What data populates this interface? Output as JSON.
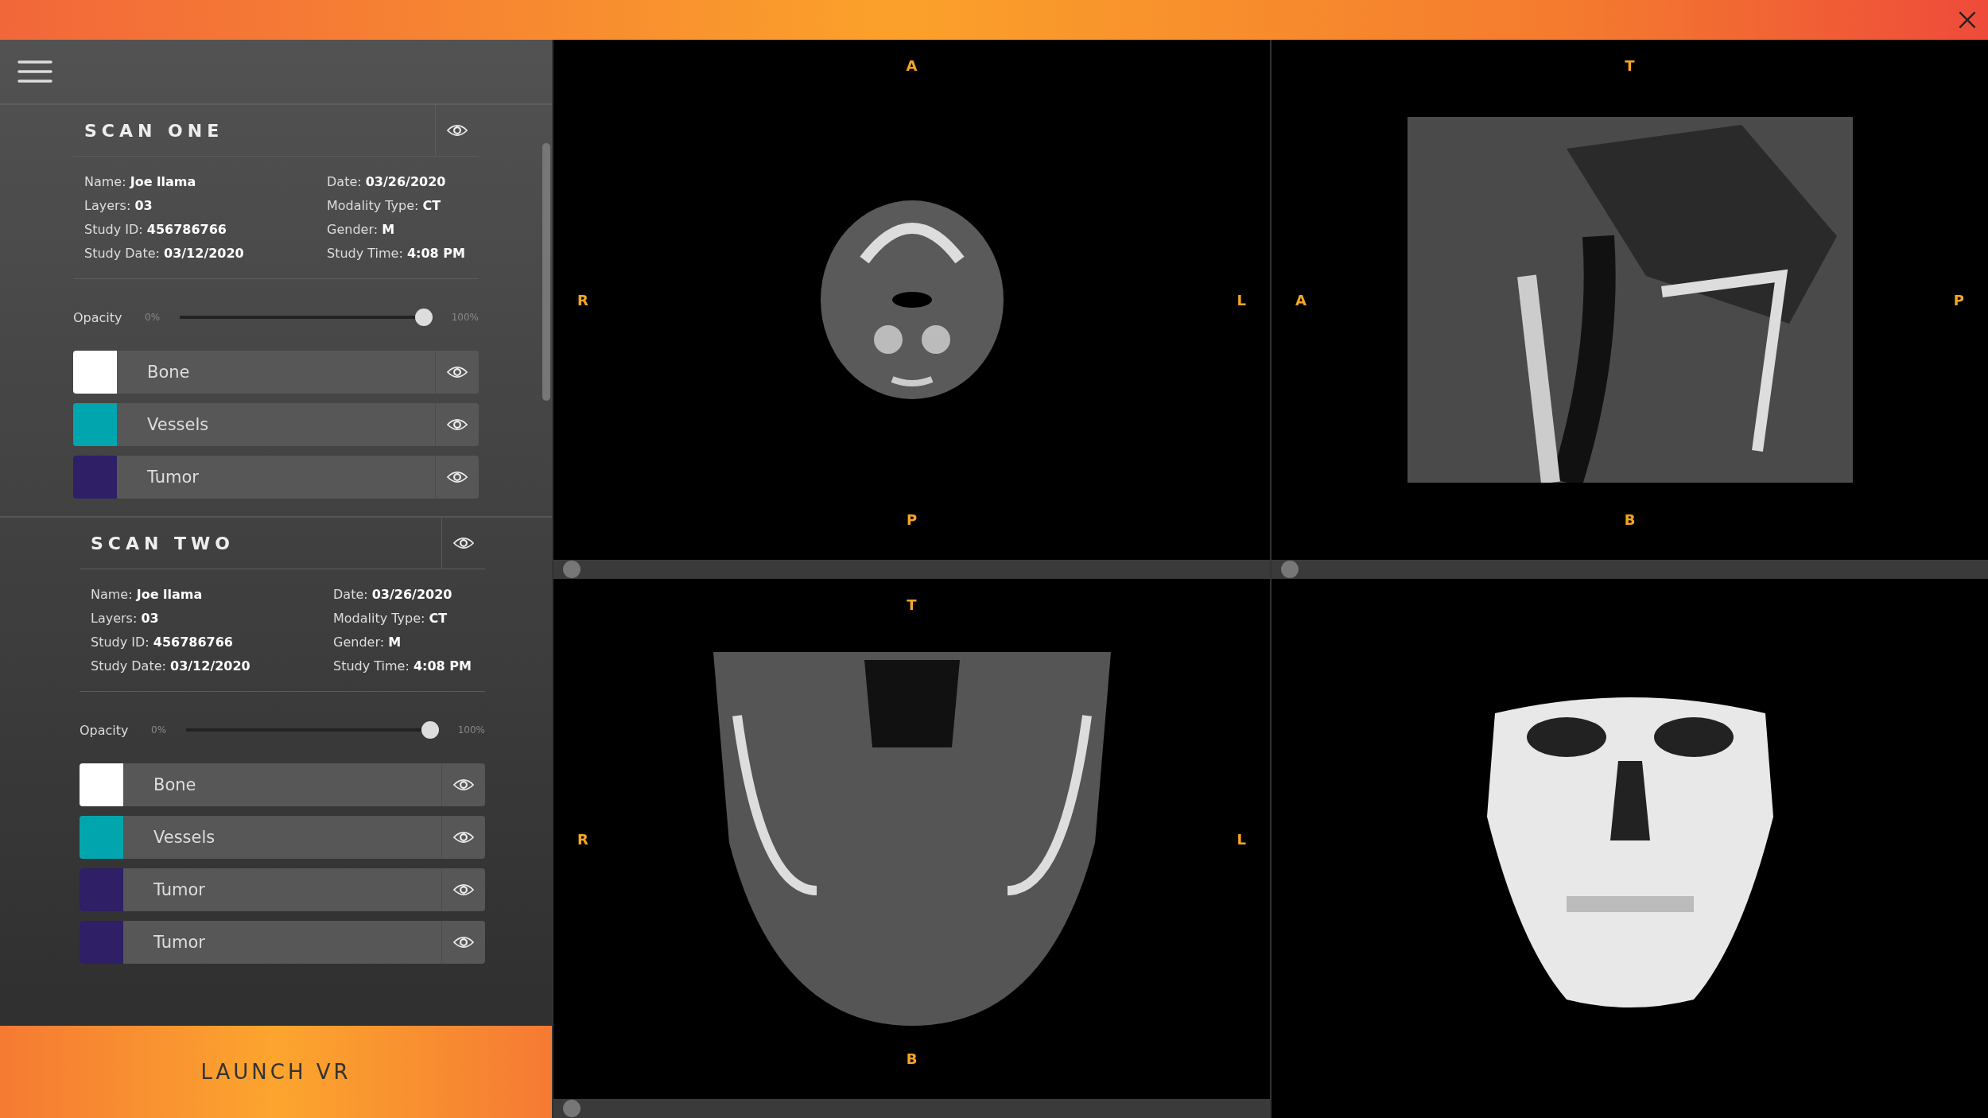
{
  "scans": [
    {
      "title": "SCAN ONE",
      "info": [
        {
          "label": "Name:",
          "value": "Joe llama"
        },
        {
          "label": "Date:",
          "value": "03/26/2020"
        },
        {
          "label": "Layers:",
          "value": "03"
        },
        {
          "label": "Modality Type:",
          "value": "CT"
        },
        {
          "label": "Study ID:",
          "value": "456786766"
        },
        {
          "label": "Gender:",
          "value": "M"
        },
        {
          "label": "Study Date:",
          "value": "03/12/2020"
        },
        {
          "label": "Study Time:",
          "value": "4:08 PM"
        }
      ],
      "opacity": {
        "label": "Opacity",
        "min": "0%",
        "max": "100%",
        "level": 0.97
      },
      "layers": [
        {
          "name": "Bone",
          "color": "#ffffff"
        },
        {
          "name": "Vessels",
          "color": "#00a5ad"
        },
        {
          "name": "Tumor",
          "color": "#2e1f66"
        }
      ]
    },
    {
      "title": "SCAN TWO",
      "info": [
        {
          "label": "Name:",
          "value": "Joe llama"
        },
        {
          "label": "Date:",
          "value": "03/26/2020"
        },
        {
          "label": "Layers:",
          "value": "03"
        },
        {
          "label": "Modality Type:",
          "value": "CT"
        },
        {
          "label": "Study ID:",
          "value": "456786766"
        },
        {
          "label": "Gender:",
          "value": "M"
        },
        {
          "label": "Study Date:",
          "value": "03/12/2020"
        },
        {
          "label": "Study Time:",
          "value": "4:08 PM"
        }
      ],
      "opacity": {
        "label": "Opacity",
        "min": "0%",
        "max": "100%",
        "level": 0.97
      },
      "layers": [
        {
          "name": "Bone",
          "color": "#ffffff"
        },
        {
          "name": "Vessels",
          "color": "#00a5ad"
        },
        {
          "name": "Tumor",
          "color": "#2e1f66"
        },
        {
          "name": "Tumor",
          "color": "#2e1f66"
        }
      ]
    }
  ],
  "launch_button": "LAUNCH VR",
  "views": [
    {
      "kind": "axial",
      "top": "A",
      "left": "R",
      "right": "L",
      "bottom": "P",
      "slider": {
        "level": 0
      }
    },
    {
      "kind": "sagittal",
      "top": "T",
      "left": "A",
      "right": "P",
      "bottom": "B",
      "slider": {
        "level": 0
      }
    },
    {
      "kind": "coronal",
      "top": "T",
      "left": "R",
      "right": "L",
      "bottom": "B",
      "slider": {
        "level": 0
      }
    },
    {
      "kind": "volume"
    }
  ]
}
